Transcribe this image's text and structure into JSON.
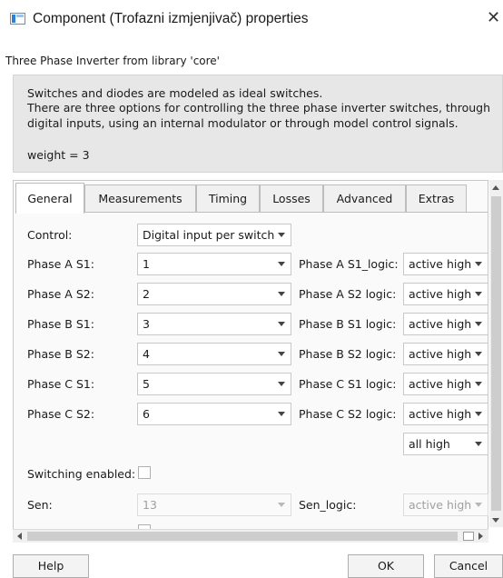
{
  "window": {
    "title": "Component (Trofazni izmjenjivač) properties",
    "close_label": "✕",
    "icon": "component-window-icon"
  },
  "subtitle": "Three Phase Inverter from library 'core'",
  "description": {
    "lines": [
      "Switches and diodes are modeled as ideal switches.",
      "There are three options for controlling the three phase inverter switches, through",
      "digital inputs, using an internal modulator or through model control signals."
    ],
    "weight": "weight = 3"
  },
  "tabs": [
    "General",
    "Measurements",
    "Timing",
    "Losses",
    "Advanced",
    "Extras"
  ],
  "active_tab": "General",
  "general": {
    "control": {
      "label": "Control:",
      "value": "Digital input per switch"
    },
    "phases": [
      {
        "label": "Phase A S1:",
        "value": "1",
        "logic_label": "Phase A S1_logic:",
        "logic_value": "active high"
      },
      {
        "label": "Phase A S2:",
        "value": "2",
        "logic_label": "Phase A S2 logic:",
        "logic_value": "active high"
      },
      {
        "label": "Phase B S1:",
        "value": "3",
        "logic_label": "Phase B S1 logic:",
        "logic_value": "active high"
      },
      {
        "label": "Phase B S2:",
        "value": "4",
        "logic_label": "Phase B S2 logic:",
        "logic_value": "active high"
      },
      {
        "label": "Phase C S1:",
        "value": "5",
        "logic_label": "Phase C S1 logic:",
        "logic_value": "active high"
      },
      {
        "label": "Phase C S2:",
        "value": "6",
        "logic_label": "Phase C S2 logic:",
        "logic_value": "active high"
      }
    ],
    "all_logic": {
      "value": "all high"
    },
    "switching_enabled": {
      "label": "Switching enabled:",
      "checked": false
    },
    "sen": {
      "label": "Sen:",
      "value": "13",
      "logic_label": "Sen_logic:",
      "logic_value": "active high",
      "disabled": true
    }
  },
  "buttons": {
    "help": "Help",
    "ok": "OK",
    "cancel": "Cancel"
  }
}
